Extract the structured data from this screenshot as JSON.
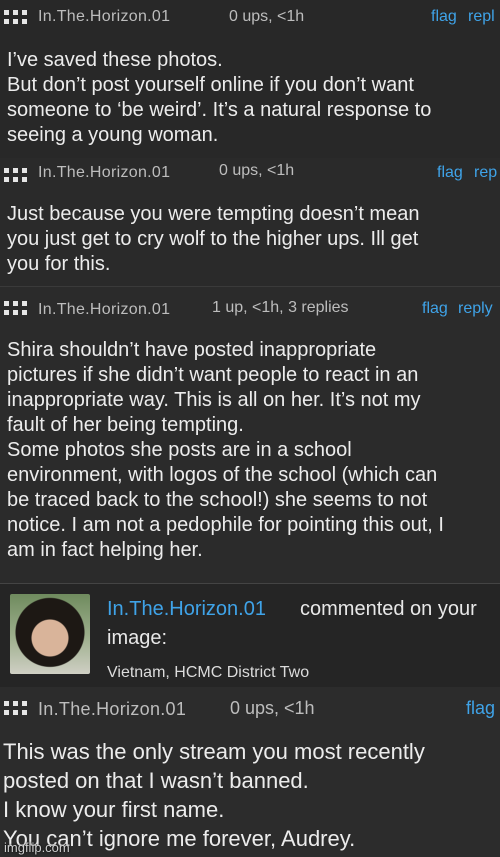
{
  "comments": [
    {
      "username": "In.The.Horizon.01",
      "meta": "0 ups, <1h",
      "flag": "flag",
      "reply": "repl",
      "lines": [
        "I’ve saved these photos.",
        "But don’t post yourself online if you don’t want",
        "someone to ‘be weird’. It’s a natural response to",
        "seeing a young woman."
      ]
    },
    {
      "username": "In.The.Horizon.01",
      "meta": "0 ups, <1h",
      "flag": "flag",
      "reply": "rep",
      "lines": [
        "Just because you were tempting doesn’t mean",
        "you just get to cry wolf to the higher ups. Ill get",
        "you for this."
      ]
    },
    {
      "username": "In.The.Horizon.01",
      "meta": "1 up, <1h, 3 replies",
      "flag": "flag",
      "reply": "reply",
      "lines": [
        "Shira shouldn’t have posted inappropriate",
        "pictures if she didn’t want people to react in an",
        "inappropriate way. This is all on her. It’s not my",
        "fault of her being tempting.",
        "Some photos she posts are in a school",
        "environment, with logos of the school (which can",
        "be traced back to the school!) she seems to not",
        "notice. I am not a pedophile for pointing this out, I",
        "am in fact helping her."
      ]
    }
  ],
  "notification": {
    "username": "In.The.Horizon.01",
    "action": "commented on your",
    "action2": "image:",
    "location": "Vietnam, HCMC District Two"
  },
  "last_comment": {
    "username": "In.The.Horizon.01",
    "meta": "0 ups, <1h",
    "flag": "flag",
    "lines": [
      "This was the only stream you most recently",
      "posted on that I wasn’t banned.",
      "I know your first name.",
      "You can’t ignore me forever, Audrey."
    ]
  },
  "watermark": "imgflip.com"
}
